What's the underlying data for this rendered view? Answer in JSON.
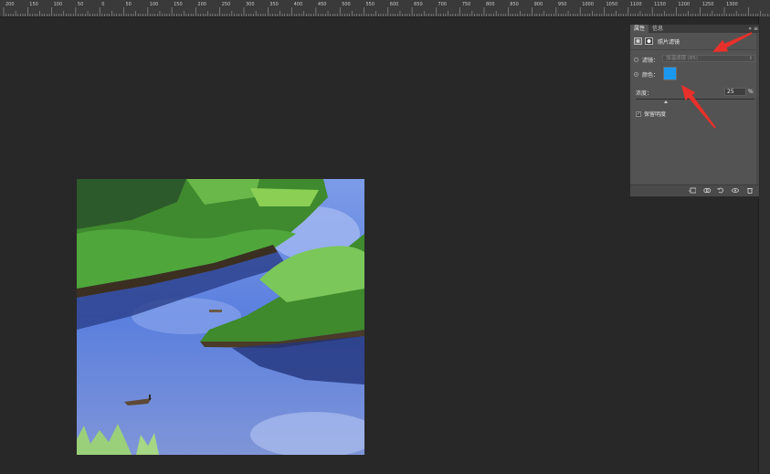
{
  "ruler": {
    "labels": [
      "200",
      "150",
      "100",
      "50",
      "0",
      "50",
      "100",
      "150",
      "200",
      "250",
      "300",
      "350",
      "400",
      "450",
      "500",
      "550",
      "600",
      "650",
      "700",
      "750",
      "800",
      "850",
      "900",
      "950",
      "1000",
      "1050",
      "1100",
      "1150",
      "1200",
      "1250",
      "1300"
    ]
  },
  "panel": {
    "tabs": [
      {
        "label": "属性",
        "active": true
      },
      {
        "label": "信息",
        "active": false
      }
    ],
    "collapse_icon": "double-chevron-right-icon",
    "menu_icon": "panel-menu-icon",
    "header_title": "照片滤镜",
    "filter": {
      "label": "滤镜：",
      "value": "加温滤镜 (85)",
      "selected": false
    },
    "color": {
      "label": "颜色：",
      "selected": true,
      "swatch": "#1a98f0"
    },
    "density": {
      "label": "浓度：",
      "value": "25",
      "unit": "%",
      "level_percent": 25
    },
    "preserve_luminosity": {
      "label": "保留明度",
      "checked": true,
      "check_glyph": "✓"
    },
    "footer_icons": [
      "clip-to-layer-icon",
      "view-previous-state-icon",
      "reset-icon",
      "visibility-icon",
      "trash-icon"
    ]
  },
  "annotation": {
    "arrow_color": "#e8302a"
  }
}
